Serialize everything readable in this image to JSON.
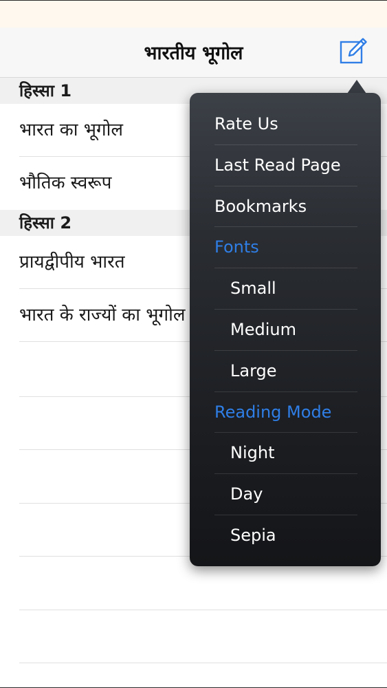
{
  "nav": {
    "title": "भारतीय भूगोल",
    "compose_icon": "compose-icon"
  },
  "sections": [
    {
      "header": "हिस्सा 1",
      "rows": [
        "भारत का भूगोल",
        "भौतिक स्वरूप"
      ]
    },
    {
      "header": "हिस्सा 2",
      "rows": [
        "प्रायद्वीपीय भारत",
        "भारत के राज्यों का भूगोल"
      ]
    }
  ],
  "menu": {
    "items": [
      {
        "label": "Rate Us"
      },
      {
        "label": "Last Read Page"
      },
      {
        "label": "Bookmarks"
      }
    ],
    "fonts_header": "Fonts",
    "fonts": [
      {
        "label": "Small"
      },
      {
        "label": "Medium"
      },
      {
        "label": "Large"
      }
    ],
    "reading_mode_header": "Reading Mode",
    "reading_modes": [
      {
        "label": "Night"
      },
      {
        "label": "Day"
      },
      {
        "label": "Sepia"
      }
    ]
  },
  "colors": {
    "accent": "#2f7ee6",
    "menu_bg": "#2a2d32",
    "status_bar": "#fff8ee"
  }
}
